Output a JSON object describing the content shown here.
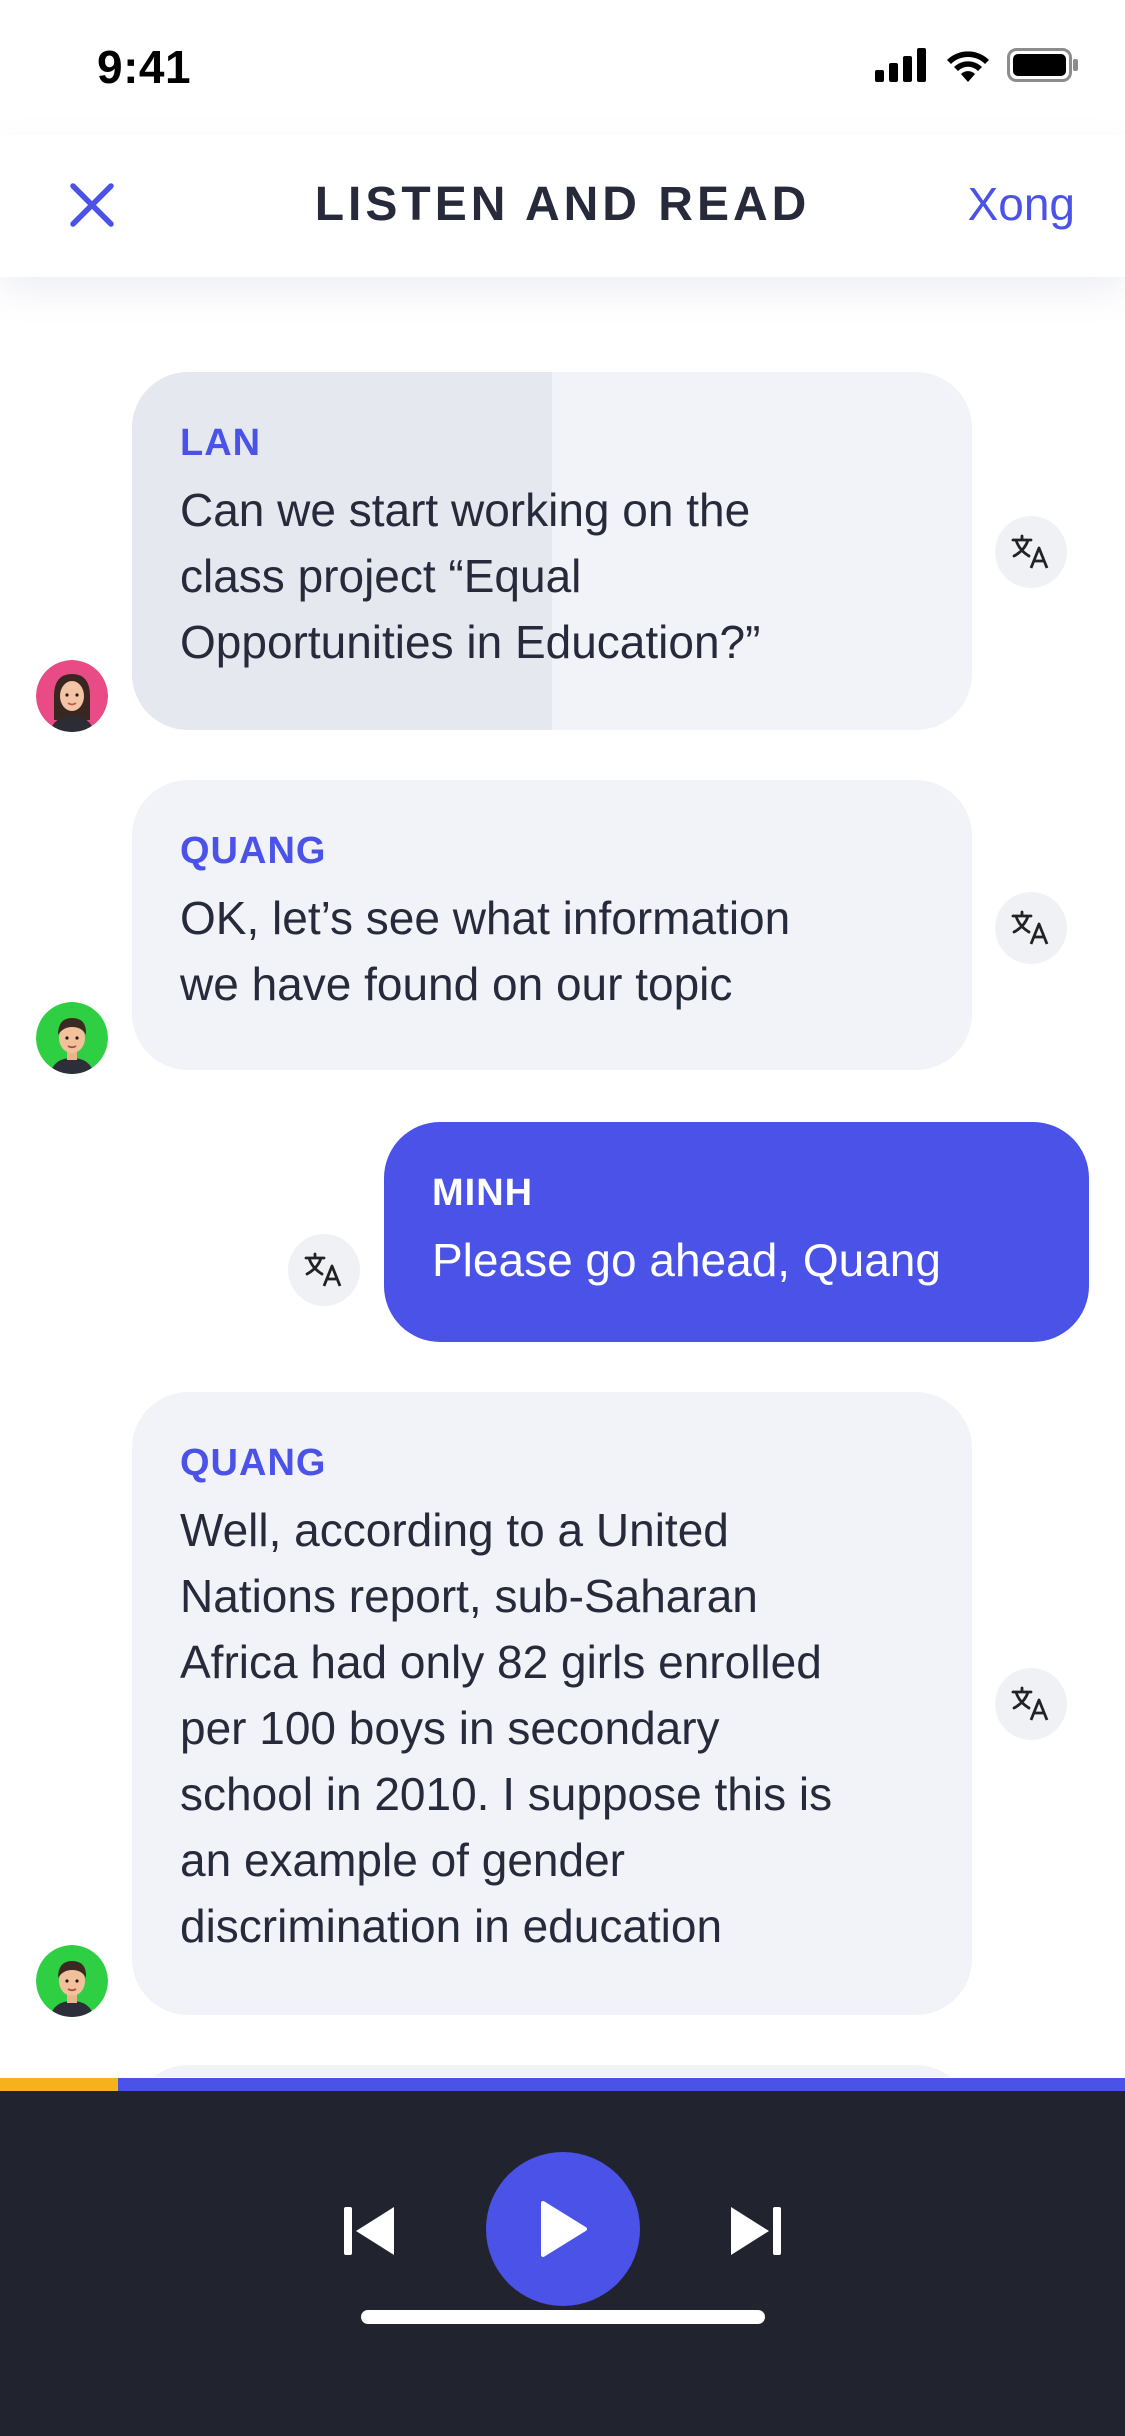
{
  "status_bar": {
    "time": "9:41"
  },
  "header": {
    "title": "LISTEN AND READ",
    "done_label": "Xong"
  },
  "messages": [
    {
      "speaker": "LAN",
      "lines": [
        "Can we start working on the",
        "class project “Equal",
        "Opportunities in Education?”"
      ],
      "mine": false,
      "avatar": "girl-avatar"
    },
    {
      "speaker": "QUANG",
      "lines": [
        "OK, let’s see what information",
        "we have found on our topic"
      ],
      "mine": false,
      "avatar": "boy-avatar"
    },
    {
      "speaker": "MINH",
      "lines": [
        "Please go ahead, Quang"
      ],
      "mine": true
    },
    {
      "speaker": "QUANG",
      "lines": [
        "Well, according to a United",
        "Nations report, sub-Saharan",
        "Africa had only 82 girls enrolled",
        "per 100 boys in secondary",
        "school in 2010. I suppose this is",
        "an example of gender",
        "discrimination in education"
      ],
      "mine": false,
      "avatar": "boy-avatar"
    }
  ],
  "player": {
    "progress": 0.105,
    "state": "paused"
  },
  "colors": {
    "accent": "#4a52e8",
    "progress": "#f6b21b",
    "player_bg": "#21242f",
    "bubble": "#f2f3f8"
  },
  "icons": {
    "close": "close-icon",
    "translate": "translate-icon",
    "play": "play-icon",
    "previous": "skip-previous-icon",
    "next": "skip-next-icon"
  }
}
